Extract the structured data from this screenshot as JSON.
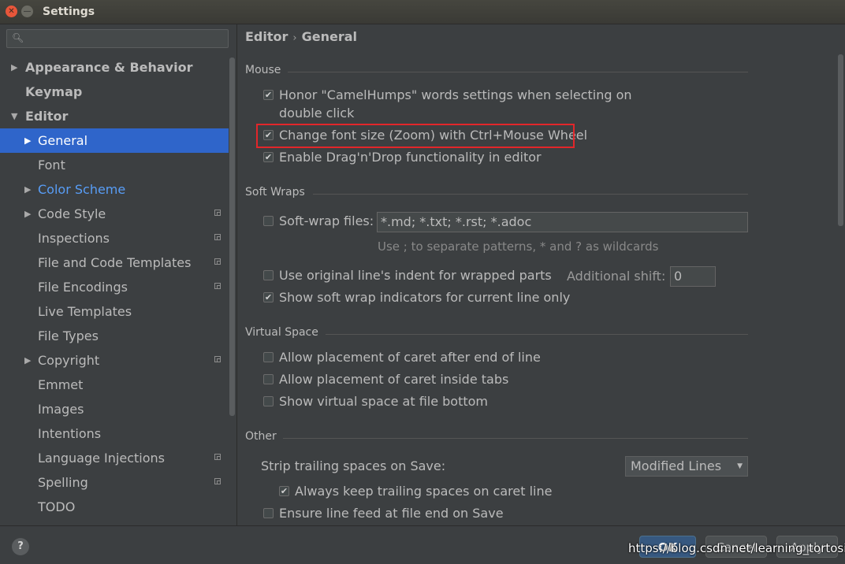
{
  "window": {
    "title": "Settings"
  },
  "search": {
    "placeholder": ""
  },
  "tree": [
    {
      "label": "Appearance & Behavior",
      "arrow": "▶"
    },
    {
      "label": "Keymap"
    },
    {
      "label": "Editor",
      "arrow": "▼"
    },
    {
      "label": "General",
      "arrow": "▶"
    },
    {
      "label": "Font"
    },
    {
      "label": "Color Scheme",
      "arrow": "▶"
    },
    {
      "label": "Code Style",
      "arrow": "▶"
    },
    {
      "label": "Inspections"
    },
    {
      "label": "File and Code Templates"
    },
    {
      "label": "File Encodings"
    },
    {
      "label": "Live Templates"
    },
    {
      "label": "File Types"
    },
    {
      "label": "Copyright",
      "arrow": "▶"
    },
    {
      "label": "Emmet"
    },
    {
      "label": "Images"
    },
    {
      "label": "Intentions"
    },
    {
      "label": "Language Injections"
    },
    {
      "label": "Spelling"
    },
    {
      "label": "TODO"
    }
  ],
  "breadcrumb": {
    "parent": "Editor",
    "separator": "›",
    "current": "General"
  },
  "mouse": {
    "title": "Mouse",
    "camel_humps_line1": "Honor \"CamelHumps\" words settings when selecting on",
    "camel_humps_line2": "double click",
    "camel_humps_checked": true,
    "zoom_label": "Change font size (Zoom) with Ctrl+Mouse Wheel",
    "zoom_checked": true,
    "dnd_label": "Enable Drag'n'Drop functionality in editor",
    "dnd_checked": true
  },
  "soft_wraps": {
    "title": "Soft Wraps",
    "files_label": "Soft-wrap files:",
    "files_checked": false,
    "files_value": "*.md; *.txt; *.rst; *.adoc",
    "hint": "Use ; to separate patterns, * and ? as wildcards",
    "indent_label": "Use original line's indent for wrapped parts",
    "indent_checked": false,
    "shift_label": "Additional shift:",
    "shift_value": "0",
    "indicators_label": "Show soft wrap indicators for current line only",
    "indicators_checked": true
  },
  "virtual_space": {
    "title": "Virtual Space",
    "caret_eol_label": "Allow placement of caret after end of line",
    "caret_eol_checked": false,
    "caret_tabs_label": "Allow placement of caret inside tabs",
    "caret_tabs_checked": false,
    "bottom_label": "Show virtual space at file bottom",
    "bottom_checked": false
  },
  "other": {
    "title": "Other",
    "strip_label": "Strip trailing spaces on Save:",
    "strip_value": "Modified Lines",
    "keep_label": "Always keep trailing spaces on caret line",
    "keep_checked": true,
    "linefeed_label": "Ensure line feed at file end on Save",
    "linefeed_checked": false
  },
  "footer": {
    "help_label": "?",
    "ok_label": "OK",
    "cancel_label": "Cancel",
    "apply_label": "Apply",
    "watermark": "https://blog.csdn.net/learning_tortosie"
  },
  "colors": {
    "background": "#3c3f41",
    "selection": "#2f65ca",
    "link": "#589df6",
    "highlight_box": "#e2262a"
  },
  "icons": {
    "close": "close-icon",
    "minimize": "minimize-icon",
    "search": "search-icon",
    "copy": "project-settings-icon",
    "dropdown": "chevron-down-icon"
  }
}
